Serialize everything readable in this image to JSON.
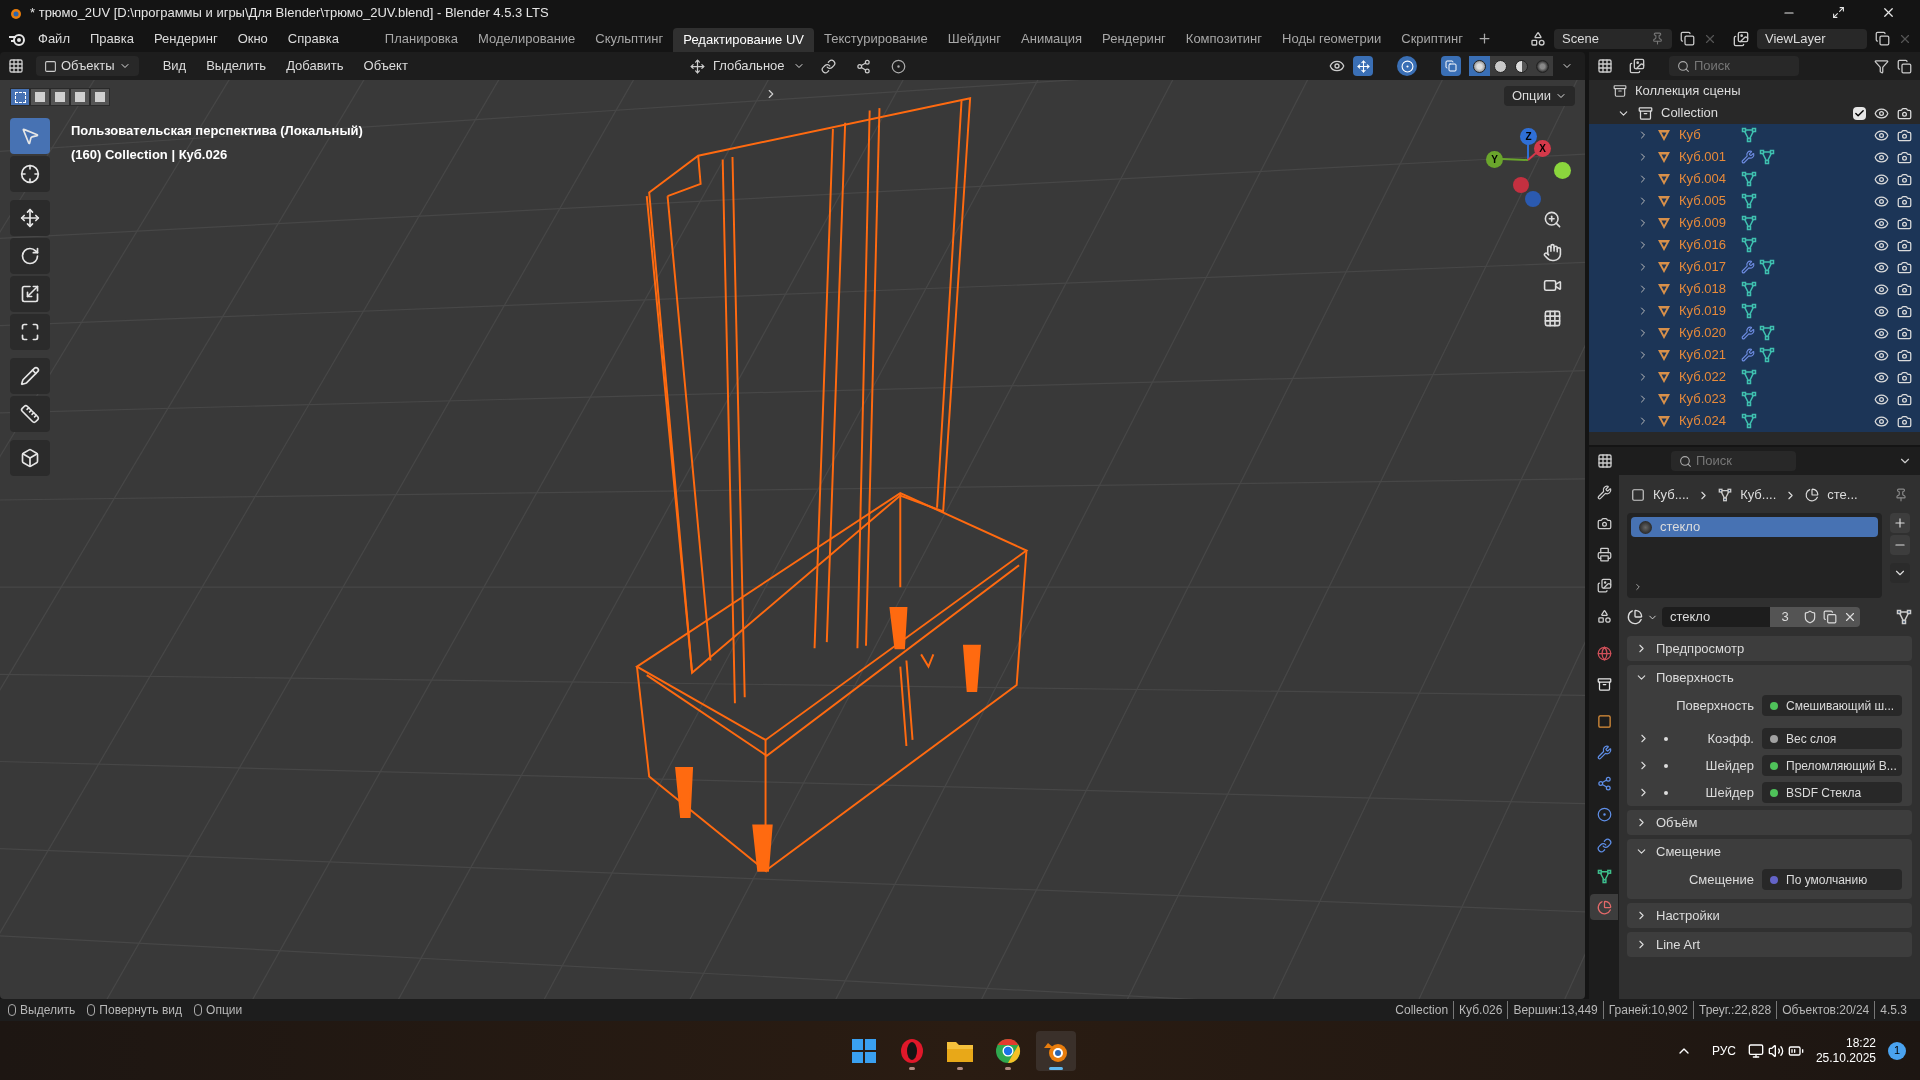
{
  "window": {
    "title": "* трюмо_2UV [D:\\программы и игры\\Для Blender\\трюмо_2UV.blend] - Blender 4.5.3 LTS"
  },
  "menu": [
    "Файл",
    "Правка",
    "Рендеринг",
    "Окно",
    "Справка"
  ],
  "workspaces": [
    {
      "label": "Планировка",
      "selected": false
    },
    {
      "label": "Моделирование",
      "selected": false
    },
    {
      "label": "Скульптинг",
      "selected": false
    },
    {
      "label": "Редактирование UV",
      "selected": true
    },
    {
      "label": "Текстурирование",
      "selected": false
    },
    {
      "label": "Шейдинг",
      "selected": false
    },
    {
      "label": "Анимация",
      "selected": false
    },
    {
      "label": "Рендеринг",
      "selected": false
    },
    {
      "label": "Композитинг",
      "selected": false
    },
    {
      "label": "Ноды геометрии",
      "selected": false
    },
    {
      "label": "Скриптинг",
      "selected": false
    }
  ],
  "scene": {
    "name": "Scene"
  },
  "view_layer": {
    "name": "ViewLayer"
  },
  "viewport": {
    "mode": "Объекты",
    "menus": [
      "Вид",
      "Выделить",
      "Добавить",
      "Объект"
    ],
    "orientation": "Глобальное",
    "options": "Опции",
    "view_name": "Пользовательская перспектива (Локальный)",
    "collection_info": "(160) Collection | Куб.026",
    "select_modes": [
      {
        "selected": true
      },
      {
        "selected": false
      },
      {
        "selected": false
      },
      {
        "selected": false
      },
      {
        "selected": false
      }
    ],
    "tools": [
      {
        "kind": "select",
        "selected": true
      },
      {
        "kind": "cursor",
        "selected": false
      },
      {
        "kind": "move",
        "selected": false
      },
      {
        "kind": "rotate",
        "selected": false
      },
      {
        "kind": "scale",
        "selected": false
      },
      {
        "kind": "transform",
        "selected": false
      },
      {
        "kind": "annotate",
        "selected": false
      },
      {
        "kind": "measure",
        "selected": false
      },
      {
        "kind": "add_cube",
        "selected": false
      }
    ],
    "shading": [
      {
        "kind": "wireframe",
        "selected": true
      },
      {
        "kind": "solid",
        "selected": false
      },
      {
        "kind": "material",
        "selected": false
      },
      {
        "kind": "rendered",
        "selected": false
      }
    ],
    "xray": true,
    "gizmo": [
      {
        "label": "Z",
        "color": "#2f6fd6"
      },
      {
        "label": "Y",
        "color": "#6aa52c"
      },
      {
        "label": "X",
        "color": "#d4394a"
      }
    ]
  },
  "outliner": {
    "search": {
      "placeholder": "Поиск"
    },
    "root": "Коллекция сцены",
    "collection": {
      "name": "Collection",
      "expanded": true,
      "checked": true,
      "children": [
        {
          "name": "Куб",
          "modifier": false
        },
        {
          "name": "Куб.001",
          "modifier": true
        },
        {
          "name": "Куб.004",
          "modifier": false
        },
        {
          "name": "Куб.005",
          "modifier": false
        },
        {
          "name": "Куб.009",
          "modifier": false
        },
        {
          "name": "Куб.016",
          "modifier": false
        },
        {
          "name": "Куб.017",
          "modifier": true
        },
        {
          "name": "Куб.018",
          "modifier": false
        },
        {
          "name": "Куб.019",
          "modifier": false
        },
        {
          "name": "Куб.020",
          "modifier": true
        },
        {
          "name": "Куб.021",
          "modifier": true
        },
        {
          "name": "Куб.022",
          "modifier": false
        },
        {
          "name": "Куб.023",
          "modifier": false
        },
        {
          "name": "Куб.024",
          "modifier": false
        }
      ]
    }
  },
  "properties": {
    "search": {
      "placeholder": "Поиск"
    },
    "tabs": [
      {
        "kind": "tool",
        "selected": false
      },
      {
        "kind": "render",
        "selected": false
      },
      {
        "kind": "output",
        "selected": false
      },
      {
        "kind": "view_layer",
        "selected": false
      },
      {
        "kind": "scene",
        "selected": false
      },
      {
        "kind": "world",
        "selected": false
      },
      {
        "kind": "collection",
        "selected": false
      },
      {
        "kind": "object",
        "selected": false
      },
      {
        "kind": "modifiers",
        "selected": false
      },
      {
        "kind": "particles",
        "selected": false
      },
      {
        "kind": "physics",
        "selected": false
      },
      {
        "kind": "constraints",
        "selected": false
      },
      {
        "kind": "data",
        "selected": false
      },
      {
        "kind": "material",
        "selected": true
      }
    ],
    "breadcrumb": [
      {
        "kind": "object",
        "label": "Куб...."
      },
      {
        "kind": "mesh",
        "label": "Куб...."
      },
      {
        "kind": "material",
        "label": "сте..."
      }
    ],
    "slots": [
      {
        "name": "стекло",
        "selected": true
      }
    ],
    "material": {
      "name": "стекло",
      "users": "3"
    },
    "panels": [
      {
        "title": "Предпросмотр",
        "expanded": false
      },
      {
        "title": "Поверхность",
        "expanded": true,
        "rows": [
          {
            "kind": "socket",
            "label": "Поверхность",
            "value": "Смешивающий ш...",
            "color": "#4fc25a"
          },
          {
            "kind": "input",
            "label": "Коэфф.",
            "value": "Вес слоя",
            "color": "#a1a1a1"
          },
          {
            "kind": "input",
            "label": "Шейдер",
            "value": "Преломляющий B...",
            "color": "#4fc25a"
          },
          {
            "kind": "input",
            "label": "Шейдер",
            "value": "BSDF Стекла",
            "color": "#4fc25a"
          }
        ]
      },
      {
        "title": "Объём",
        "expanded": false
      },
      {
        "title": "Смещение",
        "expanded": true,
        "rows": [
          {
            "kind": "socket",
            "label": "Смещение",
            "value": "По умолчанию",
            "color": "#6363c7"
          }
        ]
      },
      {
        "title": "Настройки",
        "expanded": false
      },
      {
        "title": "Line Art",
        "expanded": false
      }
    ]
  },
  "status_bar": {
    "hints": [
      "Выделить",
      "Повернуть вид",
      "Опции"
    ],
    "stats": [
      "Collection",
      "Куб.026",
      "Вершин:13,449",
      "Граней:10,902",
      "Треуг.:22,828",
      "Объектов:20/24",
      "4.5.3"
    ]
  },
  "taskbar": {
    "apps": [
      {
        "kind": "start",
        "running": false,
        "selected": false
      },
      {
        "kind": "opera",
        "running": true,
        "selected": false
      },
      {
        "kind": "files",
        "running": true,
        "selected": false
      },
      {
        "kind": "chrome",
        "running": true,
        "selected": false
      },
      {
        "kind": "blender",
        "running": true,
        "selected": true
      }
    ],
    "language": "РУС",
    "time": "18:22",
    "date": "25.10.2025",
    "notifications": "1"
  }
}
